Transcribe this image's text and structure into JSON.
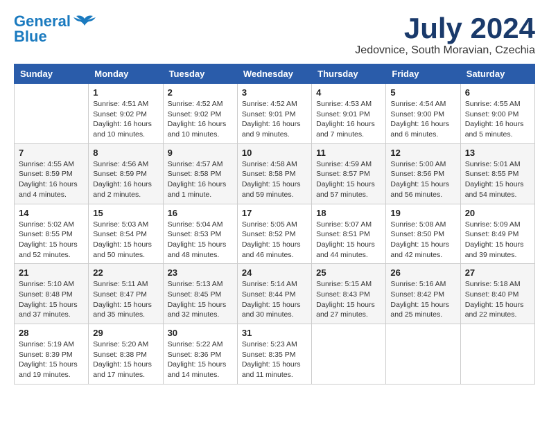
{
  "header": {
    "logo_line1": "General",
    "logo_line2": "Blue",
    "month": "July 2024",
    "location": "Jedovnice, South Moravian, Czechia"
  },
  "weekdays": [
    "Sunday",
    "Monday",
    "Tuesday",
    "Wednesday",
    "Thursday",
    "Friday",
    "Saturday"
  ],
  "weeks": [
    [
      {
        "day": "",
        "info": ""
      },
      {
        "day": "1",
        "info": "Sunrise: 4:51 AM\nSunset: 9:02 PM\nDaylight: 16 hours\nand 10 minutes."
      },
      {
        "day": "2",
        "info": "Sunrise: 4:52 AM\nSunset: 9:02 PM\nDaylight: 16 hours\nand 10 minutes."
      },
      {
        "day": "3",
        "info": "Sunrise: 4:52 AM\nSunset: 9:01 PM\nDaylight: 16 hours\nand 9 minutes."
      },
      {
        "day": "4",
        "info": "Sunrise: 4:53 AM\nSunset: 9:01 PM\nDaylight: 16 hours\nand 7 minutes."
      },
      {
        "day": "5",
        "info": "Sunrise: 4:54 AM\nSunset: 9:00 PM\nDaylight: 16 hours\nand 6 minutes."
      },
      {
        "day": "6",
        "info": "Sunrise: 4:55 AM\nSunset: 9:00 PM\nDaylight: 16 hours\nand 5 minutes."
      }
    ],
    [
      {
        "day": "7",
        "info": "Sunrise: 4:55 AM\nSunset: 8:59 PM\nDaylight: 16 hours\nand 4 minutes."
      },
      {
        "day": "8",
        "info": "Sunrise: 4:56 AM\nSunset: 8:59 PM\nDaylight: 16 hours\nand 2 minutes."
      },
      {
        "day": "9",
        "info": "Sunrise: 4:57 AM\nSunset: 8:58 PM\nDaylight: 16 hours\nand 1 minute."
      },
      {
        "day": "10",
        "info": "Sunrise: 4:58 AM\nSunset: 8:58 PM\nDaylight: 15 hours\nand 59 minutes."
      },
      {
        "day": "11",
        "info": "Sunrise: 4:59 AM\nSunset: 8:57 PM\nDaylight: 15 hours\nand 57 minutes."
      },
      {
        "day": "12",
        "info": "Sunrise: 5:00 AM\nSunset: 8:56 PM\nDaylight: 15 hours\nand 56 minutes."
      },
      {
        "day": "13",
        "info": "Sunrise: 5:01 AM\nSunset: 8:55 PM\nDaylight: 15 hours\nand 54 minutes."
      }
    ],
    [
      {
        "day": "14",
        "info": "Sunrise: 5:02 AM\nSunset: 8:55 PM\nDaylight: 15 hours\nand 52 minutes."
      },
      {
        "day": "15",
        "info": "Sunrise: 5:03 AM\nSunset: 8:54 PM\nDaylight: 15 hours\nand 50 minutes."
      },
      {
        "day": "16",
        "info": "Sunrise: 5:04 AM\nSunset: 8:53 PM\nDaylight: 15 hours\nand 48 minutes."
      },
      {
        "day": "17",
        "info": "Sunrise: 5:05 AM\nSunset: 8:52 PM\nDaylight: 15 hours\nand 46 minutes."
      },
      {
        "day": "18",
        "info": "Sunrise: 5:07 AM\nSunset: 8:51 PM\nDaylight: 15 hours\nand 44 minutes."
      },
      {
        "day": "19",
        "info": "Sunrise: 5:08 AM\nSunset: 8:50 PM\nDaylight: 15 hours\nand 42 minutes."
      },
      {
        "day": "20",
        "info": "Sunrise: 5:09 AM\nSunset: 8:49 PM\nDaylight: 15 hours\nand 39 minutes."
      }
    ],
    [
      {
        "day": "21",
        "info": "Sunrise: 5:10 AM\nSunset: 8:48 PM\nDaylight: 15 hours\nand 37 minutes."
      },
      {
        "day": "22",
        "info": "Sunrise: 5:11 AM\nSunset: 8:47 PM\nDaylight: 15 hours\nand 35 minutes."
      },
      {
        "day": "23",
        "info": "Sunrise: 5:13 AM\nSunset: 8:45 PM\nDaylight: 15 hours\nand 32 minutes."
      },
      {
        "day": "24",
        "info": "Sunrise: 5:14 AM\nSunset: 8:44 PM\nDaylight: 15 hours\nand 30 minutes."
      },
      {
        "day": "25",
        "info": "Sunrise: 5:15 AM\nSunset: 8:43 PM\nDaylight: 15 hours\nand 27 minutes."
      },
      {
        "day": "26",
        "info": "Sunrise: 5:16 AM\nSunset: 8:42 PM\nDaylight: 15 hours\nand 25 minutes."
      },
      {
        "day": "27",
        "info": "Sunrise: 5:18 AM\nSunset: 8:40 PM\nDaylight: 15 hours\nand 22 minutes."
      }
    ],
    [
      {
        "day": "28",
        "info": "Sunrise: 5:19 AM\nSunset: 8:39 PM\nDaylight: 15 hours\nand 19 minutes."
      },
      {
        "day": "29",
        "info": "Sunrise: 5:20 AM\nSunset: 8:38 PM\nDaylight: 15 hours\nand 17 minutes."
      },
      {
        "day": "30",
        "info": "Sunrise: 5:22 AM\nSunset: 8:36 PM\nDaylight: 15 hours\nand 14 minutes."
      },
      {
        "day": "31",
        "info": "Sunrise: 5:23 AM\nSunset: 8:35 PM\nDaylight: 15 hours\nand 11 minutes."
      },
      {
        "day": "",
        "info": ""
      },
      {
        "day": "",
        "info": ""
      },
      {
        "day": "",
        "info": ""
      }
    ]
  ]
}
